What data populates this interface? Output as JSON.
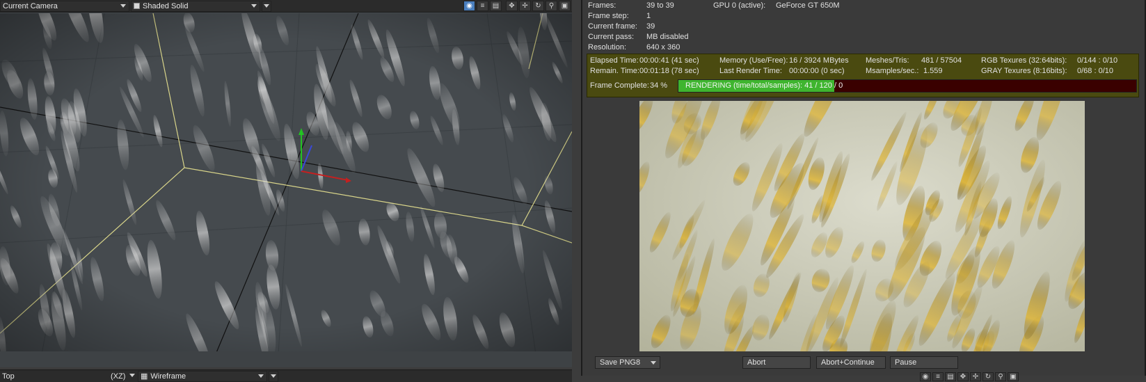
{
  "viewport": {
    "camera": "Current Camera",
    "shading": "Shaded Solid",
    "bottom_view": "Top",
    "bottom_axis": "(XZ)",
    "bottom_shading": "Wireframe",
    "toolbar_icons": [
      "camera-icon",
      "list-icon",
      "render-settings-icon",
      "move-icon",
      "pan-icon",
      "rotate-icon",
      "zoom-icon",
      "maximize-icon"
    ]
  },
  "stats": {
    "frames_label": "Frames:",
    "frames_value": "39 to 39",
    "gpu_label": "GPU 0 (active):",
    "gpu_value": "GeForce GT 650M",
    "step_label": "Frame step:",
    "step_value": "1",
    "current_frame_label": "Current frame:",
    "current_frame_value": "39",
    "pass_label": "Current pass:",
    "pass_value": "MB disabled",
    "resolution_label": "Resolution:",
    "resolution_value": "640 x 360"
  },
  "render": {
    "elapsed_label": "Elapsed Time:",
    "elapsed_value": "00:00:41 (41 sec)",
    "remain_label": "Remain. Time:",
    "remain_value": "00:01:18 (78 sec)",
    "memory_label": "Memory (Use/Free):",
    "memory_value": "16 / 3924 MBytes",
    "last_render_label": "Last Render Time:",
    "last_render_value": "00:00:00 (0 sec)",
    "meshes_label": "Meshes/Tris:",
    "meshes_value": "481 / 57504",
    "msamples_label": "Msamples/sec.:",
    "msamples_value": "1.559",
    "rgb_label": "RGB Texures (32:64bits):",
    "rgb_value": "0/144 : 0/10",
    "gray_label": "GRAY Texures (8:16bits):",
    "gray_value": "0/68 : 0/10",
    "frame_complete_label": "Frame Complete:",
    "frame_complete_value": "34 %",
    "progress_text": "RENDERING (time/total/samples): 41 / 120 / 0",
    "progress_fraction": 0.34
  },
  "buttons": {
    "save_format": "Save PNG8",
    "abort": "Abort",
    "abort_continue": "Abort+Continue",
    "pause": "Pause"
  },
  "colors": {
    "progress_fill": "#3fb52f",
    "progress_track": "#3a0000",
    "status_panel": "#4a4a10",
    "viewport_bg": "#454a4e"
  }
}
